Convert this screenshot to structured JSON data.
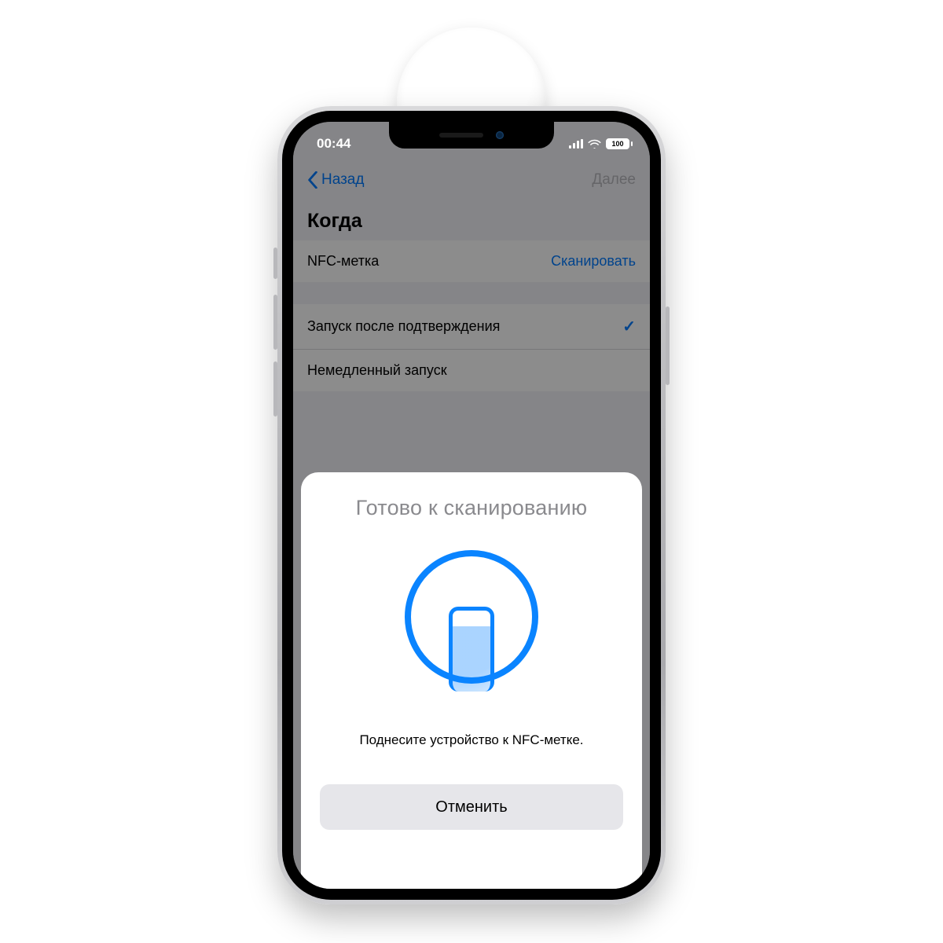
{
  "status": {
    "time": "00:44",
    "battery": "100"
  },
  "nav": {
    "back": "Назад",
    "next": "Далее"
  },
  "section": {
    "title": "Когда"
  },
  "nfc_row": {
    "label": "NFC-метка",
    "action": "Сканировать"
  },
  "options": {
    "confirm": "Запуск после подтверждения",
    "immediate": "Немедленный запуск"
  },
  "sheet": {
    "title": "Готово к сканированию",
    "subtitle": "Поднесите устройство к NFC-метке.",
    "cancel": "Отменить"
  }
}
